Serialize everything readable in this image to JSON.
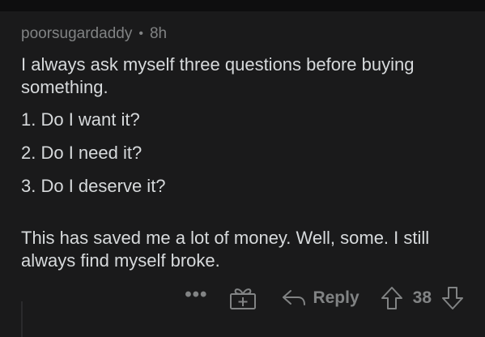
{
  "comment": {
    "author": "poorsugardaddy",
    "separator": "•",
    "age": "8h",
    "intro": "I always ask myself three questions before buying something.",
    "questions": [
      "1. Do I want it?",
      "2. Do I need it?",
      "3. Do I deserve it?"
    ],
    "outro": "This has saved me a lot of money. Well, some. I still always find myself broke."
  },
  "actions": {
    "more_label": "•••",
    "reply_label": "Reply",
    "score": "38",
    "icons": [
      "gift-icon",
      "reply-arrow-icon",
      "upvote-icon",
      "downvote-icon"
    ]
  },
  "colors": {
    "background": "#1a1a1b",
    "text": "#d7dadc",
    "muted": "#818384"
  }
}
